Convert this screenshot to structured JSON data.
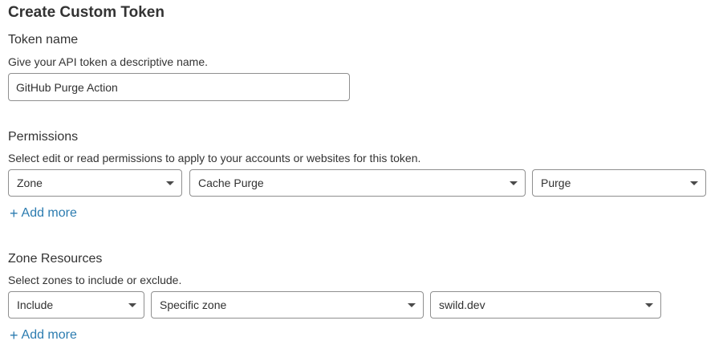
{
  "page": {
    "title": "Create Custom Token"
  },
  "token_name": {
    "title": "Token name",
    "description": "Give your API token a descriptive name.",
    "value": "GitHub Purge Action"
  },
  "permissions": {
    "title": "Permissions",
    "description": "Select edit or read permissions to apply to your accounts or websites for this token.",
    "selects": [
      {
        "value": "Zone"
      },
      {
        "value": "Cache Purge"
      },
      {
        "value": "Purge"
      }
    ],
    "add_more_icon": "+",
    "add_more_label": "Add more"
  },
  "zone_resources": {
    "title": "Zone Resources",
    "description": "Select zones to include or exclude.",
    "selects": [
      {
        "value": "Include"
      },
      {
        "value": "Specific zone"
      },
      {
        "value": "swild.dev"
      }
    ],
    "add_more_icon": "+",
    "add_more_label": "Add more"
  },
  "colors": {
    "link": "#2c7cb0",
    "border": "#8f8f8f",
    "text": "#313131"
  }
}
